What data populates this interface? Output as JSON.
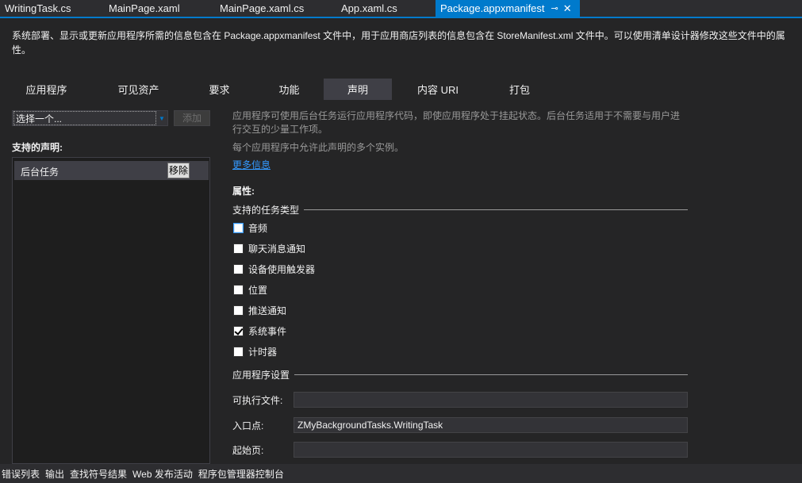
{
  "doc_tabs": [
    {
      "label": "WritingTask.cs"
    },
    {
      "label": "MainPage.xaml"
    },
    {
      "label": "MainPage.xaml.cs"
    },
    {
      "label": "App.xaml.cs"
    },
    {
      "label": "Package.appxmanifest",
      "active": true
    }
  ],
  "doc_tab_icons": {
    "pin": "⊸",
    "close": "✕"
  },
  "info_text": "系统部署、显示或更新应用程序所需的信息包含在 Package.appxmanifest 文件中，用于应用商店列表的信息包含在 StoreManifest.xml 文件中。可以使用清单设计器修改这些文件中的属性。",
  "section_tabs": [
    {
      "label": "应用程序"
    },
    {
      "label": "可见资产"
    },
    {
      "label": "要求"
    },
    {
      "label": "功能"
    },
    {
      "label": "声明",
      "active": true
    },
    {
      "label": "内容 URI"
    },
    {
      "label": "打包"
    }
  ],
  "left": {
    "combo_value": "选择一个...",
    "add_label": "添加",
    "supported_label": "支持的声明:",
    "declarations": [
      {
        "name": "后台任务",
        "remove_label": "移除"
      }
    ]
  },
  "right": {
    "description": "应用程序可使用后台任务运行应用程序代码，即使应用程序处于挂起状态。后台任务适用于不需要与用户进行交互的少量工作项。",
    "multi_instance": "每个应用程序中允许此声明的多个实例。",
    "more_info": "更多信息",
    "properties_label": "属性:",
    "task_types_label": "支持的任务类型",
    "task_types": [
      {
        "label": "音频",
        "checked": false,
        "focus": true
      },
      {
        "label": "聊天消息通知",
        "checked": false
      },
      {
        "label": "设备使用触发器",
        "checked": false
      },
      {
        "label": "位置",
        "checked": false
      },
      {
        "label": "推送通知",
        "checked": false
      },
      {
        "label": "系统事件",
        "checked": true
      },
      {
        "label": "计时器",
        "checked": false
      }
    ],
    "app_settings_label": "应用程序设置",
    "executable_label": "可执行文件:",
    "executable_value": "",
    "entry_label": "入口点:",
    "entry_value": "ZMyBackgroundTasks.WritingTask",
    "start_page_label": "起始页:",
    "start_page_value": ""
  },
  "bottom_tabs": [
    {
      "label": "错误列表"
    },
    {
      "label": "输出"
    },
    {
      "label": "查找符号结果"
    },
    {
      "label": "Web 发布活动"
    },
    {
      "label": "程序包管理器控制台"
    }
  ]
}
